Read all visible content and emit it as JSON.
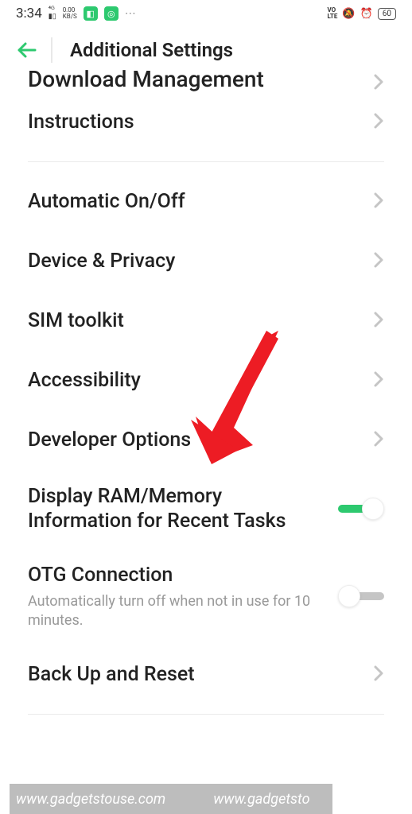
{
  "status": {
    "time": "3:34",
    "signal": "4G",
    "kbs": "0.00\nKB/S",
    "volte": "VO\nLTE",
    "battery": "60"
  },
  "header": {
    "title": "Additional Settings"
  },
  "partial_item": {
    "label": "Download Management"
  },
  "items": [
    {
      "label": "Instructions",
      "type": "nav"
    }
  ],
  "items2": [
    {
      "label": "Automatic On/Off",
      "type": "nav"
    },
    {
      "label": "Device & Privacy",
      "type": "nav"
    },
    {
      "label": "SIM toolkit",
      "type": "nav"
    },
    {
      "label": "Accessibility",
      "type": "nav"
    },
    {
      "label": "Developer Options",
      "type": "nav"
    },
    {
      "label": "Display RAM/Memory Information for Recent Tasks",
      "type": "toggle",
      "on": true
    },
    {
      "label": "OTG Connection",
      "sub": "Automatically turn off when not in use for 10 minutes.",
      "type": "toggle",
      "on": false
    },
    {
      "label": "Back Up and Reset",
      "type": "nav"
    }
  ],
  "watermark": {
    "text1": "www.gadgetstouse.com",
    "text2": "www.gadgetsto"
  }
}
